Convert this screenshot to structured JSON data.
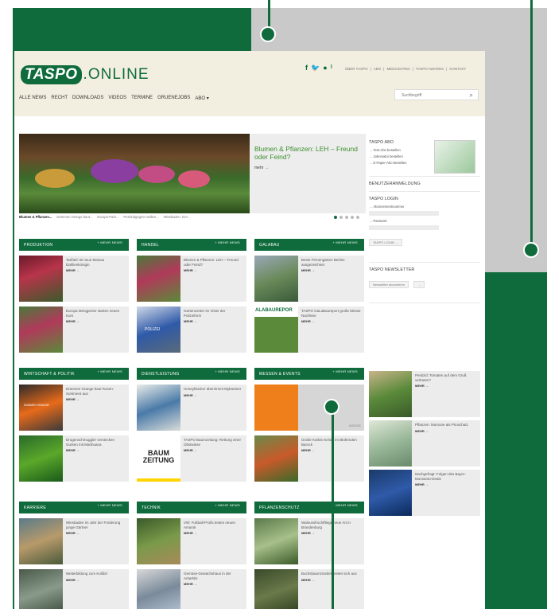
{
  "colors": {
    "brand_green": "#0f6b3c",
    "accent_green": "#3c8f2e",
    "header_bg": "#f3efe0",
    "callout_gray": "#c8c9c8"
  },
  "header": {
    "logo_box": "TASPO",
    "logo_suffix": ".ONLINE",
    "social_icons": [
      "facebook-icon",
      "twitter-icon",
      "whatsapp-icon",
      "rss-icon"
    ],
    "top_links": [
      "ÜBER TASPO",
      "ABO",
      "MEDIADATEN",
      "TASPO AWARDS",
      "KONTAKT"
    ],
    "nav": [
      "ALLE NEWS",
      "RECHT",
      "DOWNLOADS",
      "VIDEOS",
      "TERMINE",
      "GRUENEJOBS",
      "ABO ▾"
    ],
    "search_placeholder": "Suchbegriff"
  },
  "hero": {
    "headline": "Blumen & Pflanzen: LEH – Freund oder Feind?",
    "more": "mehr →",
    "thumbs": [
      "Blumen & Pflanzen...",
      "Dümmen Orange baut...",
      "Europa-Park...",
      "Pestizidgegner wollen...",
      "Wiesbaden: IGA..."
    ]
  },
  "sidebar": {
    "abo_title": "TASPO ABO",
    "abo_links": [
      "Test-Abo bestellen",
      "Jahresabo bestellen",
      "E-Paper-Abo bestellen"
    ],
    "login_section": "BENUTZERANMELDUNG",
    "login_title": "TASPO LOGIN",
    "abo_number_label": "Abonnementnummer",
    "password_label": "Passwort",
    "login_button": "TASPO LOGIN →",
    "newsletter_title": "TASPO NEWSLETTER",
    "newsletter_select": "Newsletter abonnieren"
  },
  "more_label": "MEHR →",
  "more_news": "+ MEHR NEWS",
  "sections": [
    {
      "title": "PRODUKTION",
      "items": [
        "Tarifairl: Bi neue Mainau Dahlienkönigin",
        "Europa Mengpreier starten neuen Kurs"
      ]
    },
    {
      "title": "HANDEL",
      "items": [
        "Blumen & Pflanzen: LEH – Freund oder Feind?",
        "Gartencenter im Visier der Polizeiform"
      ]
    },
    {
      "title": "GALABAU",
      "items": [
        "Beste Firmengärten Berlins ausgezeichnet",
        "TASPO GaLaBaureport große Messe Nachlese"
      ]
    },
    {
      "title": "WIRTSCHAFT & POLITIK",
      "items": [
        "Dümmen Orange baut Rosen-Sortiment aus",
        "Drogenschmuggler verstecken Gurken mit Marihuana"
      ]
    },
    {
      "title": "DIENSTLEISTUNG",
      "items": [
        "Honeyblocker übernimmt Mykantner",
        "TASPO Baumzeitung: Rettung einer Obstwiese"
      ]
    },
    {
      "title": "MESSEN & EVENTS",
      "items": [
        "",
        "Große Kürbis-Schau im Blühenden Barock"
      ]
    },
    {
      "title": "KARRIERE",
      "items": [
        "Wiesbaden im Jahr der Förderung junge Gärtner",
        "Weiterbildung zum Kollibri"
      ]
    },
    {
      "title": "TECHNIK",
      "items": [
        "VW: Fußball-Profis testen neuen Amarok",
        "Gemüse-Gewächshaus in der Antarktis"
      ]
    },
    {
      "title": "PFLANZENSCHUTZ",
      "items": [
        "Walnussfruchtfliege neue Art in Brandenburg",
        "Buchsbaumzünsler breitet sich aus"
      ]
    }
  ],
  "side_news": [
    "Pestizid: Tomaten auf dem Gruß verboten?",
    "Pflanzen: Momone als Prioschutz",
    "Nachgefragt: Folgen des Bayer-Monsanto-Deals"
  ],
  "image_labels": {
    "police": "POLIZEI",
    "baum_line1": "BAUM",
    "baum_line2": "ZEITUNG",
    "galabau": "ALABAUREPOR",
    "dummen": "DÜMMEN ORANGE",
    "events_tag": "ANZEIGE"
  }
}
